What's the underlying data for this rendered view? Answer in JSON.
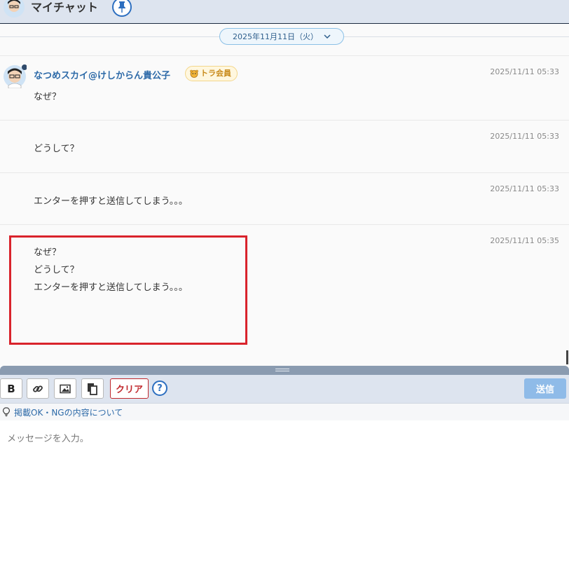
{
  "header": {
    "title": "マイチャット"
  },
  "chat": {
    "date_label": "2025年11月11日（火）",
    "user": {
      "name": "なつめスカイ@けしからん貴公子",
      "badge": "トラ会員"
    },
    "messages": [
      {
        "time": "2025/11/11 05:33",
        "lines": [
          "なぜ？"
        ]
      },
      {
        "time": "2025/11/11 05:33",
        "lines": [
          "どうして？"
        ]
      },
      {
        "time": "2025/11/11 05:33",
        "lines": [
          "エンターを押すと送信してしまう。。。"
        ]
      },
      {
        "time": "2025/11/11 05:35",
        "lines": [
          "なぜ？",
          "どうして？",
          "エンターを押すと送信してしまう。。。"
        ]
      }
    ]
  },
  "toolbar": {
    "bold_label": "B",
    "clear_label": "クリア",
    "help_label": "?",
    "send_label": "送信"
  },
  "guide": {
    "link_text": "掲載OK・NGの内容について"
  },
  "composer": {
    "placeholder": "メッセージを入力。"
  },
  "colors": {
    "accent": "#2d6fc0",
    "highlight": "#d9232c",
    "send_disabled": "#8fbbe8"
  }
}
